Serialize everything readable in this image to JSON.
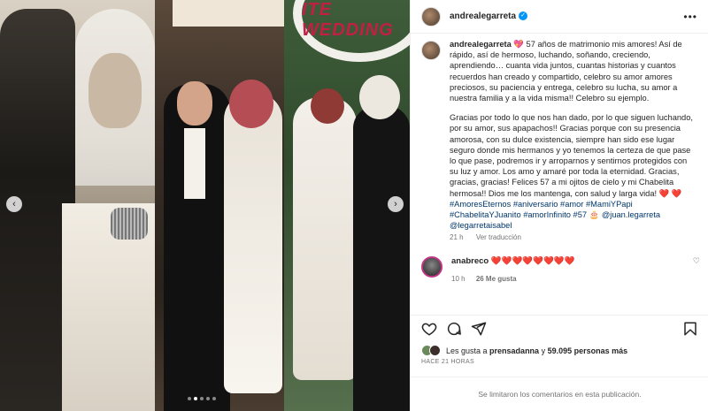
{
  "post": {
    "username": "andrealegarreta",
    "more_icon": "more-horizontal-icon"
  },
  "caption": {
    "username": "andrealegarreta",
    "paragraph1": "💖 57 años de matrimonio mis amores! Así de rápido, así de hermoso, luchando, soñando, creciendo, aprendiendo… cuanta vida juntos, cuantas historias y cuantos recuerdos han creado y compartido, celebro su amor amores preciosos, su paciencia y entrega, celebro su lucha, su amor a nuestra familia y a la vida misma!! Celebro su ejemplo.",
    "paragraph2": "Gracias por todo lo que nos han dado, por lo que siguen luchando, por su amor, sus apapachos!! Gracias porque con su presencia amorosa, con su dulce existencia, siempre han sido ese lugar seguro donde mis hermanos y yo tenemos la certeza de que pase lo que pase, podremos ir y arroparnos y sentirnos protegidos con su luz y amor. Los amo y amaré por toda la eternidad. Gracias, gracias, gracias! Felices 57 a mi ojitos de cielo y mi Chabelita hermosa!! Dios me los mantenga, con salud y larga vida! ❤️ ❤️",
    "hashtags": "#AmoresEternos #aniversario #amor #MamiYPapi #ChabelitaYJuanito #amorInfinito #57 🎂",
    "mentions": "@juan.legarreta @legarretaisabel",
    "time": "21 h",
    "translate": "Ver traducción"
  },
  "comment": {
    "username": "anabreco",
    "text": "❤️❤️❤️❤️❤️❤️❤️❤️",
    "time": "10 h",
    "likes": "26 Me gusta"
  },
  "likes": {
    "prefix": "Les gusta a ",
    "user": "prensadanna",
    "middle": " y ",
    "count": "59.095 personas más"
  },
  "timestamp": "HACE 21 HORAS",
  "comments_limited": "Se limitaron los comentarios en esta publicación.",
  "media": {
    "sign_text": "ITE WEDDING",
    "carousel_total": 5,
    "carousel_active": 2
  },
  "colors": {
    "verified": "#0095f6",
    "link": "#00376b",
    "secondary_text": "#737373"
  }
}
